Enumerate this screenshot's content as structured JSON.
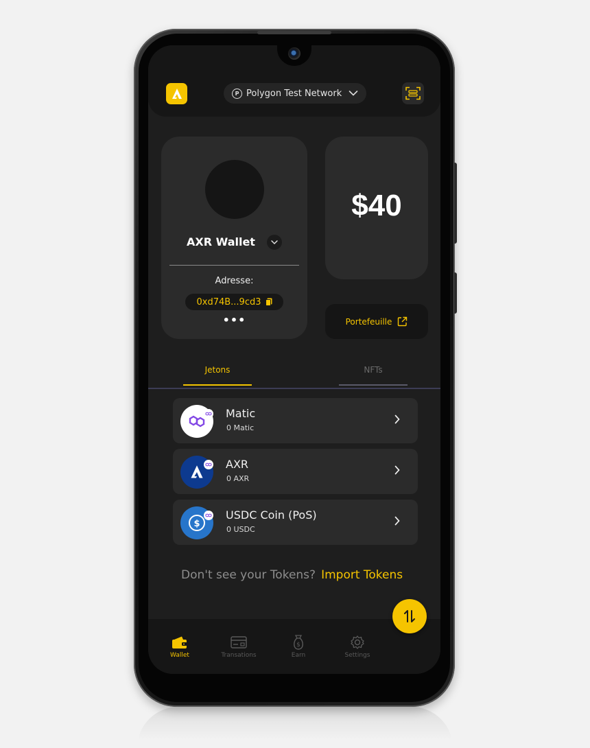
{
  "header": {
    "logo_icon": "axr-logo-icon",
    "network_label": "Polygon Test Network",
    "network_badge": "P",
    "scan_icon": "scan-icon"
  },
  "wallet_card": {
    "name": "AXR Wallet",
    "address_label": "Adresse:",
    "address": "0xd74B...9cd3",
    "more": "•••"
  },
  "balance": {
    "value": "$40",
    "portfolio_label": "Portefeuille"
  },
  "tabs": [
    {
      "label": "Jetons",
      "active": true
    },
    {
      "label": "NFTs",
      "active": false
    }
  ],
  "tokens": [
    {
      "name": "Matic",
      "amount": "0 Matic",
      "icon": "polygon-icon"
    },
    {
      "name": "AXR",
      "amount": "0 AXR",
      "icon": "axr-icon"
    },
    {
      "name": "USDC Coin (PoS)",
      "amount": "0 USDC",
      "icon": "usdc-icon"
    }
  ],
  "import": {
    "question": "Don't see your Tokens?",
    "link": "Import Tokens"
  },
  "bottom_nav": [
    {
      "label": "Wallet",
      "icon": "wallet-icon",
      "active": true
    },
    {
      "label": "Transations",
      "icon": "card-icon",
      "active": false
    },
    {
      "label": "Earn",
      "icon": "earn-icon",
      "active": false
    },
    {
      "label": "Settings",
      "icon": "gear-icon",
      "active": false
    }
  ],
  "colors": {
    "accent": "#f5c400",
    "background": "#1e1e1e",
    "card": "#2b2b2b"
  }
}
